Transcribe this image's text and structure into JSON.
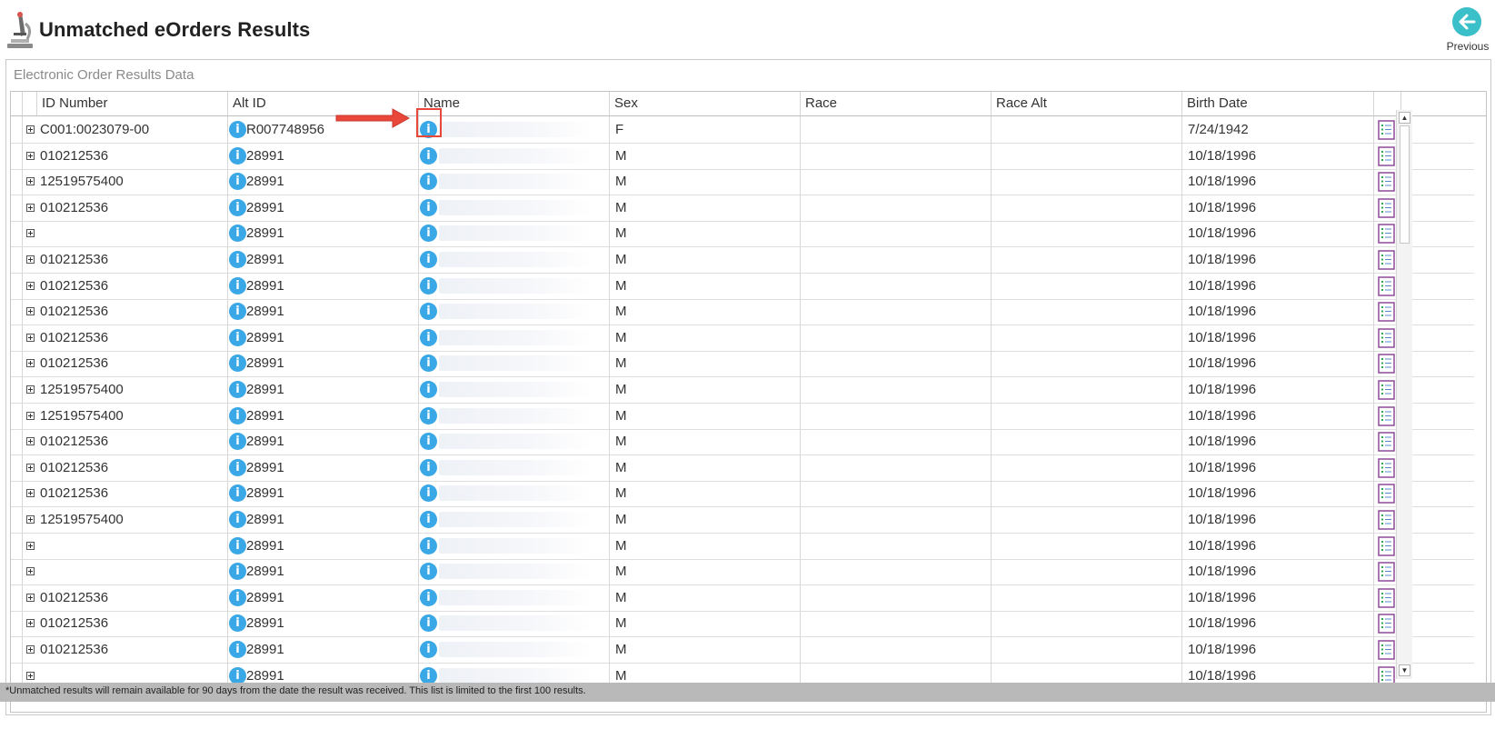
{
  "header": {
    "title": "Unmatched eOrders Results",
    "previous_label": "Previous",
    "logo_icon": "microscope-icon",
    "previous_icon": "arrow-left-circle-icon"
  },
  "panel": {
    "title": "Electronic Order Results Data"
  },
  "grid": {
    "columns": [
      "ID Number",
      "Alt ID",
      "Name",
      "Sex",
      "Race",
      "Race Alt",
      "Birth Date"
    ],
    "rows": [
      {
        "id": "C001:0023079-00",
        "alt_id": "R007748956",
        "sex": "F",
        "race": "",
        "race_alt": "",
        "birth_date": "7/24/1942"
      },
      {
        "id": "010212536",
        "alt_id": "28991",
        "sex": "M",
        "race": "",
        "race_alt": "",
        "birth_date": "10/18/1996"
      },
      {
        "id": "12519575400",
        "alt_id": "28991",
        "sex": "M",
        "race": "",
        "race_alt": "",
        "birth_date": "10/18/1996"
      },
      {
        "id": "010212536",
        "alt_id": "28991",
        "sex": "M",
        "race": "",
        "race_alt": "",
        "birth_date": "10/18/1996"
      },
      {
        "id": "",
        "alt_id": "28991",
        "sex": "M",
        "race": "",
        "race_alt": "",
        "birth_date": "10/18/1996"
      },
      {
        "id": "010212536",
        "alt_id": "28991",
        "sex": "M",
        "race": "",
        "race_alt": "",
        "birth_date": "10/18/1996"
      },
      {
        "id": "010212536",
        "alt_id": "28991",
        "sex": "M",
        "race": "",
        "race_alt": "",
        "birth_date": "10/18/1996"
      },
      {
        "id": "010212536",
        "alt_id": "28991",
        "sex": "M",
        "race": "",
        "race_alt": "",
        "birth_date": "10/18/1996"
      },
      {
        "id": "010212536",
        "alt_id": "28991",
        "sex": "M",
        "race": "",
        "race_alt": "",
        "birth_date": "10/18/1996"
      },
      {
        "id": "010212536",
        "alt_id": "28991",
        "sex": "M",
        "race": "",
        "race_alt": "",
        "birth_date": "10/18/1996"
      },
      {
        "id": "12519575400",
        "alt_id": "28991",
        "sex": "M",
        "race": "",
        "race_alt": "",
        "birth_date": "10/18/1996"
      },
      {
        "id": "12519575400",
        "alt_id": "28991",
        "sex": "M",
        "race": "",
        "race_alt": "",
        "birth_date": "10/18/1996"
      },
      {
        "id": "010212536",
        "alt_id": "28991",
        "sex": "M",
        "race": "",
        "race_alt": "",
        "birth_date": "10/18/1996"
      },
      {
        "id": "010212536",
        "alt_id": "28991",
        "sex": "M",
        "race": "",
        "race_alt": "",
        "birth_date": "10/18/1996"
      },
      {
        "id": "010212536",
        "alt_id": "28991",
        "sex": "M",
        "race": "",
        "race_alt": "",
        "birth_date": "10/18/1996"
      },
      {
        "id": "12519575400",
        "alt_id": "28991",
        "sex": "M",
        "race": "",
        "race_alt": "",
        "birth_date": "10/18/1996"
      },
      {
        "id": "",
        "alt_id": "28991",
        "sex": "M",
        "race": "",
        "race_alt": "",
        "birth_date": "10/18/1996"
      },
      {
        "id": "",
        "alt_id": "28991",
        "sex": "M",
        "race": "",
        "race_alt": "",
        "birth_date": "10/18/1996"
      },
      {
        "id": "010212536",
        "alt_id": "28991",
        "sex": "M",
        "race": "",
        "race_alt": "",
        "birth_date": "10/18/1996"
      },
      {
        "id": "010212536",
        "alt_id": "28991",
        "sex": "M",
        "race": "",
        "race_alt": "",
        "birth_date": "10/18/1996"
      },
      {
        "id": "010212536",
        "alt_id": "28991",
        "sex": "M",
        "race": "",
        "race_alt": "",
        "birth_date": "10/18/1996"
      },
      {
        "id": "",
        "alt_id": "28991",
        "sex": "M",
        "race": "",
        "race_alt": "",
        "birth_date": "10/18/1996"
      }
    ],
    "icons": {
      "expand": "expand-plus-icon",
      "info": "info-icon",
      "report": "report-document-icon"
    },
    "info_glyph": "i"
  },
  "annotation": {
    "arrow_color": "#e8473a",
    "highlight": "name-info-icon first row"
  },
  "footer": {
    "note": "*Unmatched results will remain available for 90 days from the date the result was received. This list is limited to the first 100 results."
  },
  "colors": {
    "accent": "#3aa8e6",
    "previous_button": "#3bbfc8",
    "footer_bg": "#b9b9b9",
    "report_icon": "#8e4a9a"
  }
}
